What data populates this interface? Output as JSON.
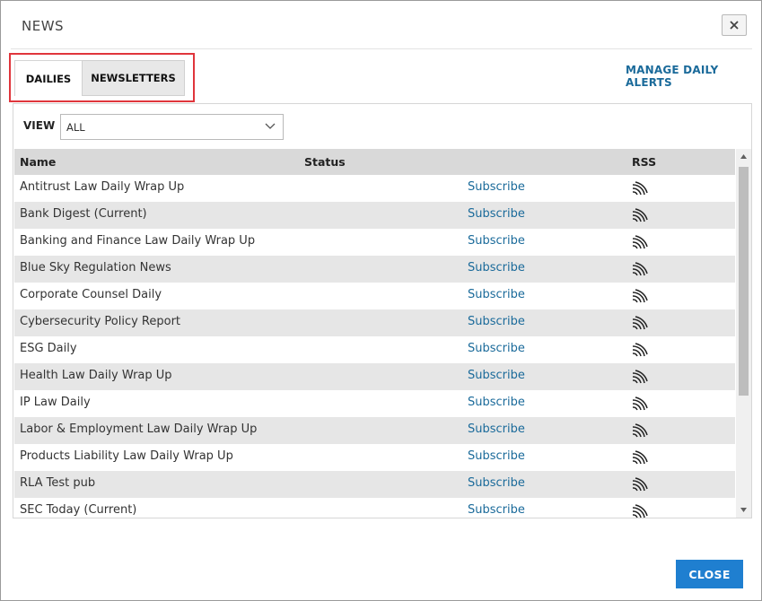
{
  "dialog": {
    "title": "NEWS"
  },
  "tabs": [
    {
      "label": "DAILIES",
      "active": true
    },
    {
      "label": "NEWSLETTERS",
      "active": false
    }
  ],
  "manage_link": "MANAGE DAILY ALERTS",
  "view": {
    "label": "VIEW",
    "selected": "ALL"
  },
  "table": {
    "headers": {
      "name": "Name",
      "status": "Status",
      "rss": "RSS"
    },
    "rows": [
      {
        "name": "Antitrust Law Daily Wrap Up",
        "action": "Subscribe"
      },
      {
        "name": "Bank Digest (Current)",
        "action": "Subscribe"
      },
      {
        "name": "Banking and Finance Law Daily Wrap Up",
        "action": "Subscribe"
      },
      {
        "name": "Blue Sky Regulation News",
        "action": "Subscribe"
      },
      {
        "name": "Corporate Counsel Daily",
        "action": "Subscribe"
      },
      {
        "name": "Cybersecurity Policy Report",
        "action": "Subscribe"
      },
      {
        "name": "ESG Daily",
        "action": "Subscribe"
      },
      {
        "name": "Health Law Daily Wrap Up",
        "action": "Subscribe"
      },
      {
        "name": "IP Law Daily",
        "action": "Subscribe"
      },
      {
        "name": "Labor & Employment Law Daily Wrap Up",
        "action": "Subscribe"
      },
      {
        "name": "Products Liability Law Daily Wrap Up",
        "action": "Subscribe"
      },
      {
        "name": "RLA Test pub",
        "action": "Subscribe"
      },
      {
        "name": "SEC Today (Current)",
        "action": "Subscribe"
      }
    ]
  },
  "footer": {
    "close_label": "CLOSE"
  },
  "colors": {
    "link": "#1a6a9a",
    "primary": "#1f7fd0",
    "highlight_border": "#e0353c"
  },
  "icons": {
    "close": "close-icon",
    "dropdown": "chevron-down-icon",
    "rss": "rss-icon"
  }
}
